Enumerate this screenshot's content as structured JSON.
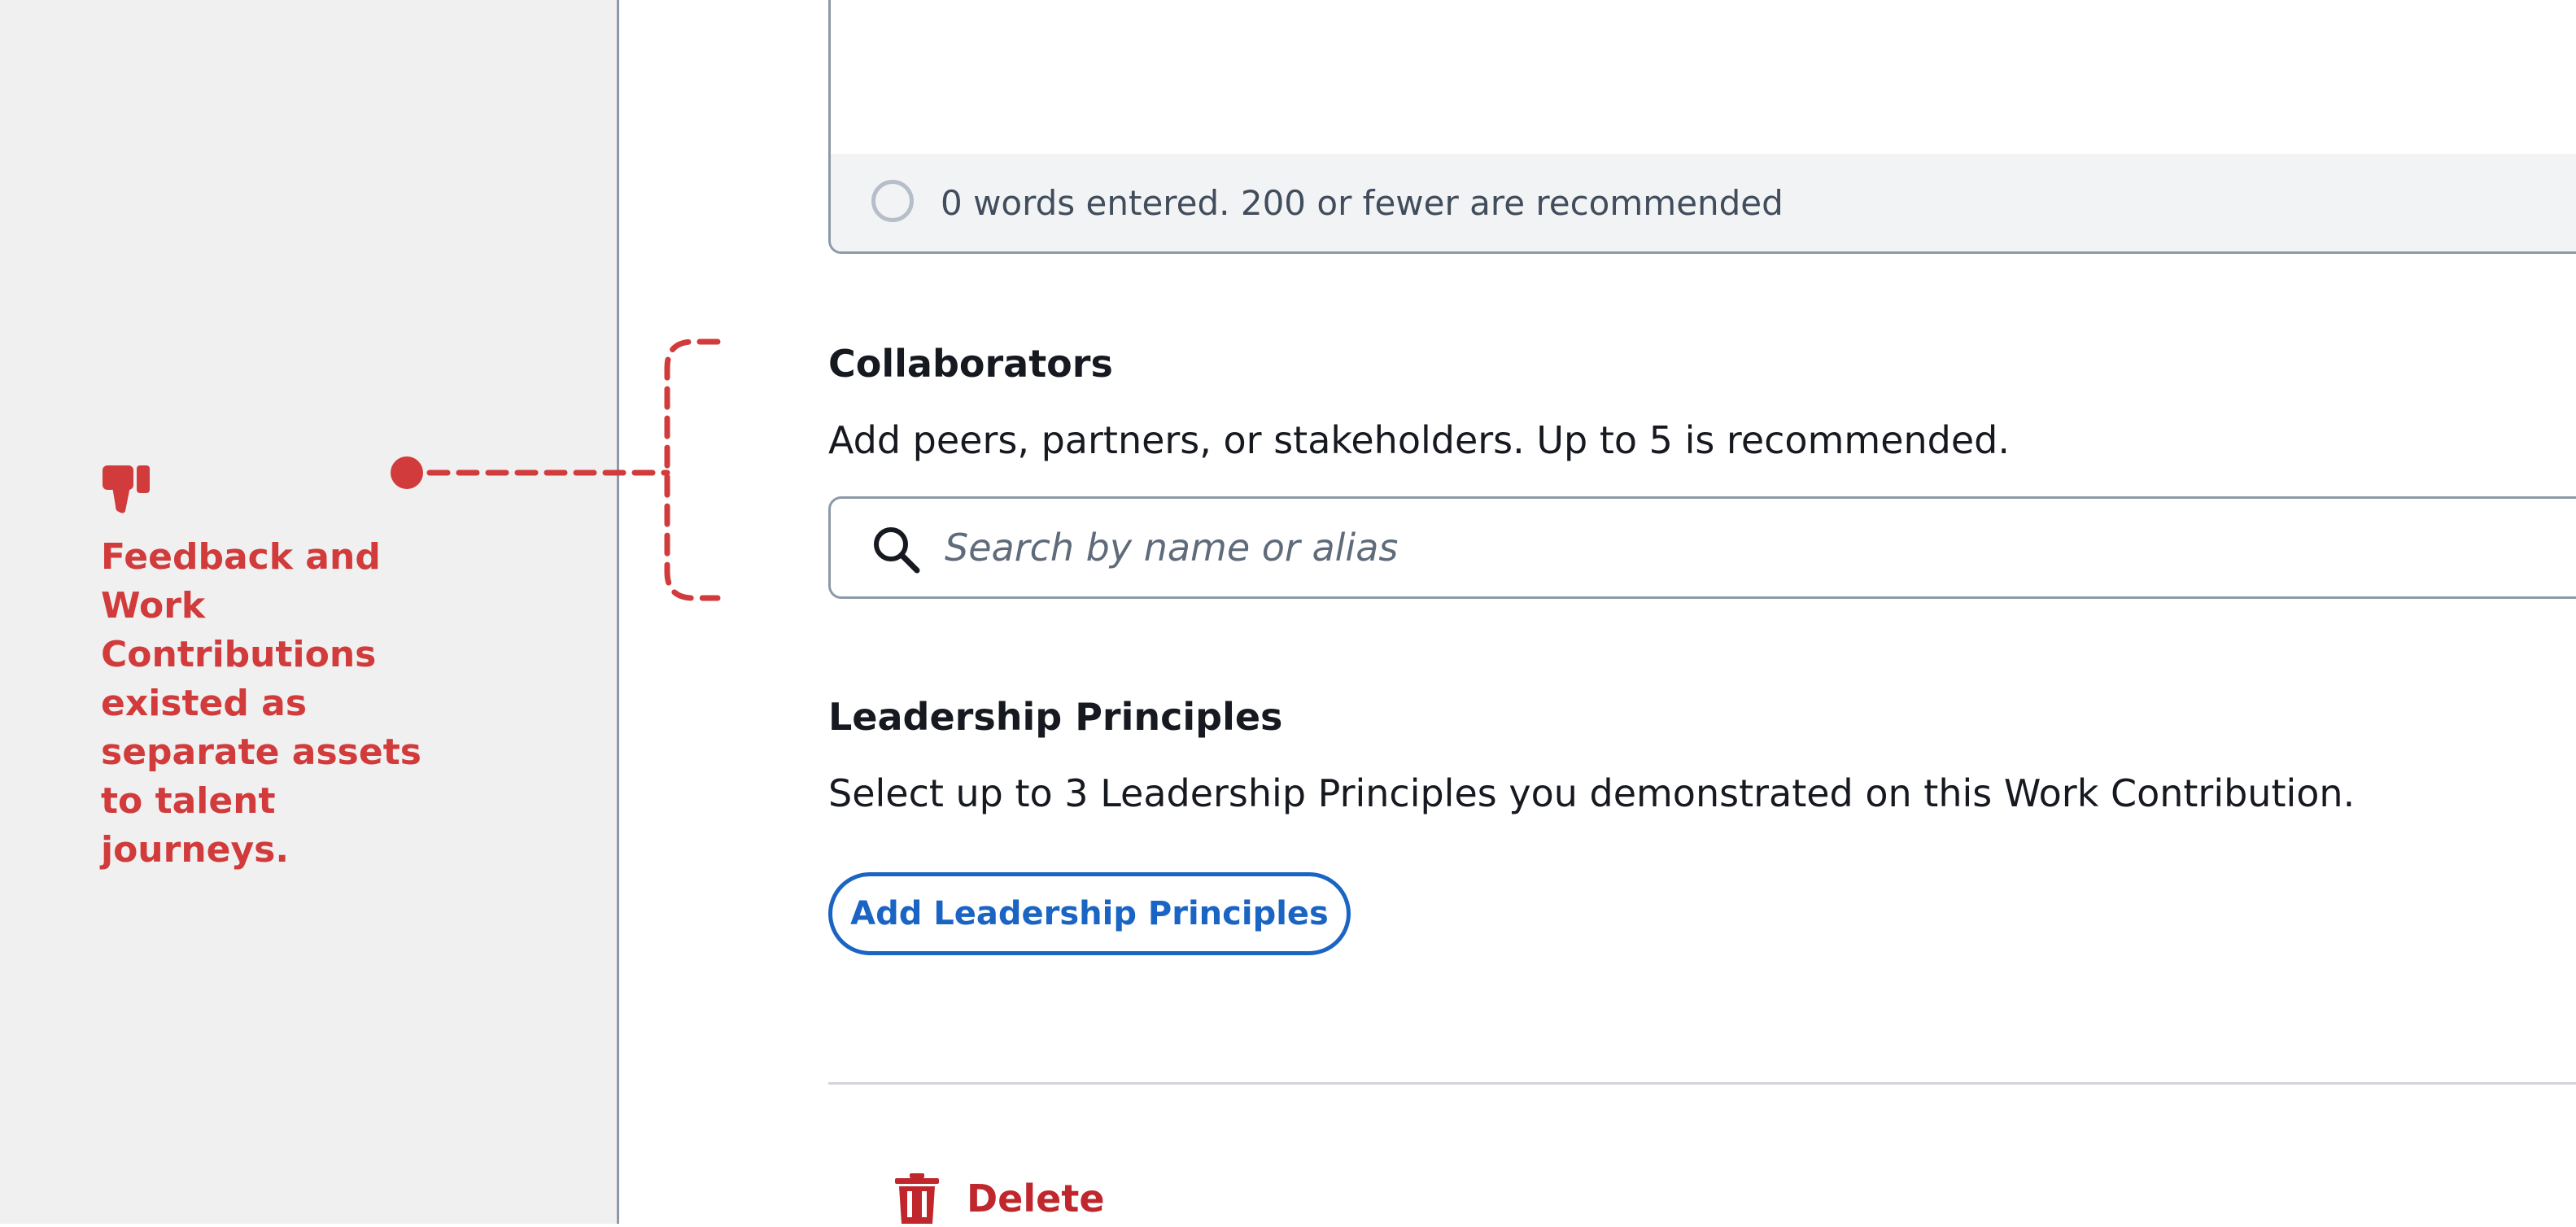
{
  "annotation": {
    "icon": "thumbs-down-icon",
    "text": "Feedback and Work Contributions existed as separate assets to talent journeys.",
    "color": "#d13b3b"
  },
  "summary_field": {
    "word_count_text": "0 words entered. 200 or fewer are recommended"
  },
  "collaborators": {
    "title": "Collaborators",
    "description": "Add peers, partners, or stakeholders. Up to 5 is recommended.",
    "search_placeholder": "Search by name or alias",
    "search_value": ""
  },
  "leadership_principles": {
    "title": "Leadership Principles",
    "description": "Select up to 3 Leadership Principles you demonstrated on this Work Contribution.",
    "add_button_label": "Add Leadership Principles"
  },
  "actions": {
    "delete_label": "Delete"
  },
  "colors": {
    "accent": "#1a64c4",
    "danger": "#c0272d",
    "annotation": "#d13b3b",
    "sidebar_bg": "#f0f0f0",
    "border": "#8d99a8"
  }
}
